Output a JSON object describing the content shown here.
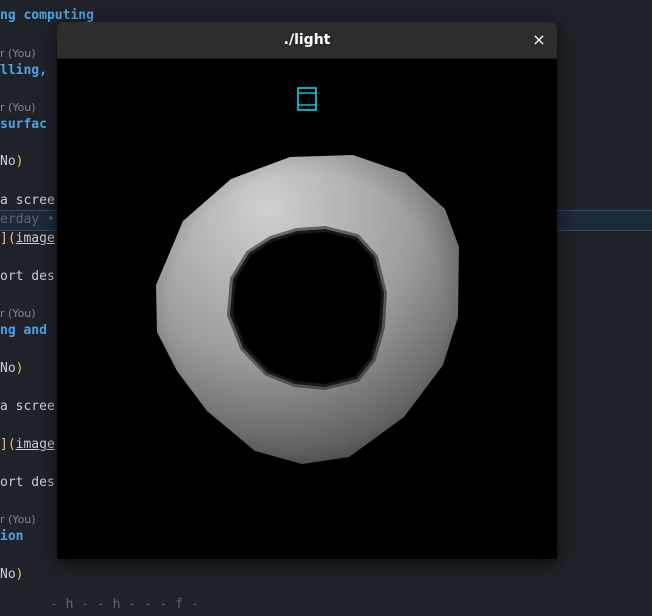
{
  "window": {
    "title": "./light",
    "close_glyph": "×"
  },
  "editor_lines": {
    "l1": "ng computing",
    "l2_meta": "r (You)",
    "l3": "lling,",
    "l4_meta": "r (You)",
    "l5": " surfac",
    "l6_text": "No",
    "l7": "a scree",
    "l8": "erday •",
    "l9_link": "image",
    "l10": "ort des",
    "l11_meta": "r (You)",
    "l12": "ng and",
    "l13_text": "No",
    "l14": "a scree",
    "l15_link": "image",
    "l16": "ort des",
    "l17_meta": "r (You)",
    "l18": "ion",
    "l19_text": "No",
    "bottom_partial": "  -  h   -   -   h  -  -  -  f  -"
  },
  "colors": {
    "heading": "#4fa3e3",
    "paren": "#e5c07b",
    "light_marker": "#00e5ff",
    "torus": "#bdbdbd"
  },
  "icons": {
    "light_marker": "light-source-icon",
    "close": "close-icon"
  }
}
